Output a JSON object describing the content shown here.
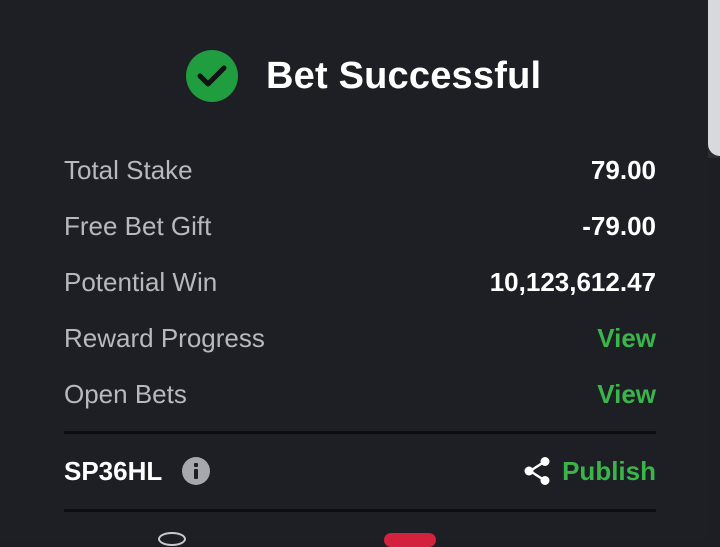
{
  "theme": {
    "accent_green": "#2fa84f",
    "link_green": "#39b54a",
    "icon_bg_green": "#1f9d3f"
  },
  "header": {
    "icon": "check-circle-icon",
    "title": "Bet Successful"
  },
  "summary": [
    {
      "label": "Total Stake",
      "value": "79.00",
      "type": "value"
    },
    {
      "label": "Free Bet Gift",
      "value": "-79.00",
      "type": "value"
    },
    {
      "label": "Potential Win",
      "value": "10,123,612.47",
      "type": "value"
    },
    {
      "label": "Reward Progress",
      "value": "View",
      "type": "link"
    },
    {
      "label": "Open Bets",
      "value": "View",
      "type": "link"
    }
  ],
  "booking": {
    "code": "SP36HL",
    "info_icon": "info-icon",
    "share_icon": "share-icon",
    "publish_label": "Publish"
  }
}
